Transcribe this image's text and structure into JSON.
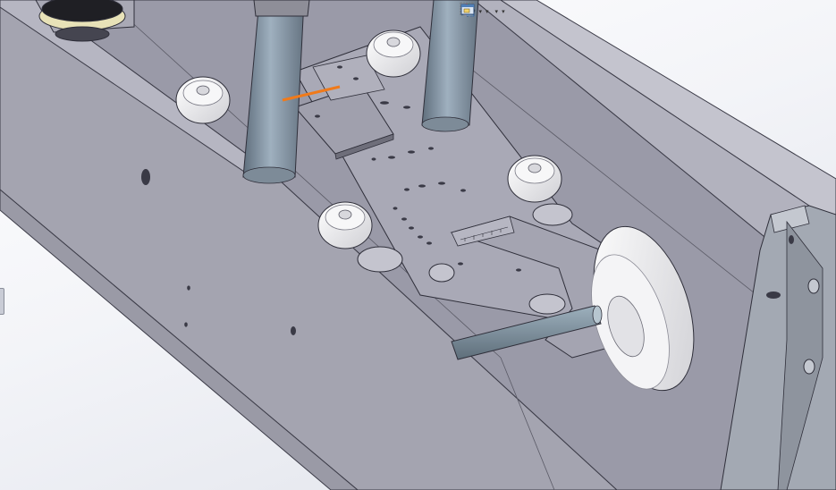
{
  "viewport": {
    "background_top": "#ffffff",
    "background_bottom": "#dfe2ea",
    "model_colors": {
      "frame_face": "#a6a6b2",
      "frame_dark": "#8c8c99",
      "frame_light": "#c3c3cd",
      "rod": "#8797a6",
      "wheel": "#eeeeee",
      "highlight_edge": "#f07a1a"
    }
  },
  "toolbar": {
    "buttons": [
      {
        "icon": "zoom-to-fit-icon",
        "dropdown": false
      },
      {
        "icon": "zoom-to-area-icon",
        "dropdown": false
      },
      {
        "icon": "previous-view-icon",
        "dropdown": false
      },
      {
        "icon": "section-view-icon",
        "dropdown": false
      },
      {
        "icon": "view-orientation-icon",
        "dropdown": true
      },
      {
        "icon": "display-style-icon",
        "dropdown": true
      },
      {
        "icon": "hide-show-items-icon",
        "dropdown": true
      },
      {
        "icon": "edit-appearance-icon",
        "dropdown": false
      },
      {
        "icon": "apply-scene-icon",
        "dropdown": true
      },
      {
        "icon": "view-settings-icon",
        "dropdown": true
      }
    ],
    "caret_glyph": "▾"
  }
}
